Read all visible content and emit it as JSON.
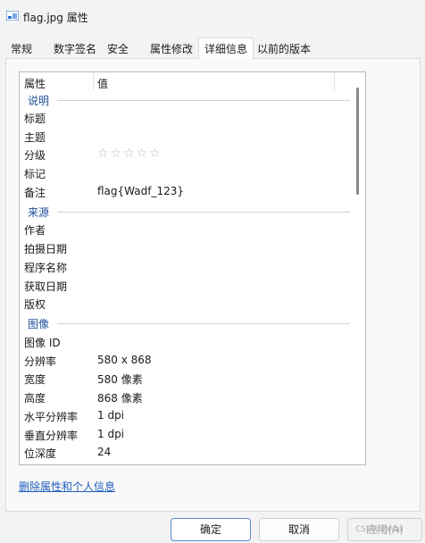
{
  "window": {
    "title": "flag.jpg 属性",
    "icon": "image-file-icon"
  },
  "tabs": [
    {
      "label": "常规",
      "active": false
    },
    {
      "label": "数字签名",
      "active": false
    },
    {
      "label": "安全",
      "active": false
    },
    {
      "label": "属性修改",
      "active": false
    },
    {
      "label": "详细信息",
      "active": true
    },
    {
      "label": "以前的版本",
      "active": false
    }
  ],
  "columns": {
    "property": "属性",
    "value": "值"
  },
  "groups": {
    "description": "说明",
    "origin": "来源",
    "image": "图像"
  },
  "rows": {
    "title": {
      "label": "标题",
      "value": ""
    },
    "subject": {
      "label": "主题",
      "value": ""
    },
    "rating": {
      "label": "分级",
      "stars": "☆☆☆☆☆",
      "rating": 0
    },
    "tags": {
      "label": "标记",
      "value": ""
    },
    "comments": {
      "label": "备注",
      "value": "flag{Wadf_123}"
    },
    "authors": {
      "label": "作者",
      "value": ""
    },
    "date_taken": {
      "label": "拍摄日期",
      "value": ""
    },
    "program": {
      "label": "程序名称",
      "value": ""
    },
    "date_acquired": {
      "label": "获取日期",
      "value": ""
    },
    "copyright": {
      "label": "版权",
      "value": ""
    },
    "image_id": {
      "label": "图像 ID",
      "value": ""
    },
    "dimensions": {
      "label": "分辨率",
      "value": "580 x 868"
    },
    "width": {
      "label": "宽度",
      "value": "580 像素"
    },
    "height": {
      "label": "高度",
      "value": "868 像素"
    },
    "hres": {
      "label": "水平分辨率",
      "value": "1 dpi"
    },
    "vres": {
      "label": "垂直分辨率",
      "value": "1 dpi"
    },
    "bit_depth": {
      "label": "位深度",
      "value": "24"
    }
  },
  "remove_link": "删除属性和个人信息",
  "buttons": {
    "ok": "确定",
    "cancel": "取消",
    "apply": "应用(A)"
  },
  "watermark": "CSDN @Nar"
}
